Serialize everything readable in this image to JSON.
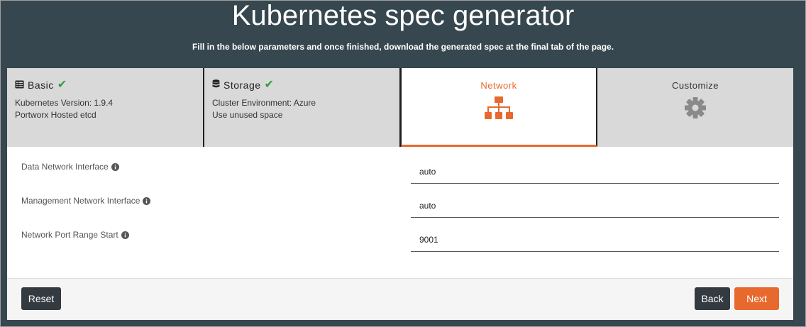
{
  "header": {
    "title": "Kubernetes spec generator",
    "subtitle": "Fill in the below parameters and once finished, download the generated spec at the final tab of the page."
  },
  "tabs": [
    {
      "label": "Basic",
      "icon": "list-icon",
      "completed": true,
      "lines": [
        "Kubernetes Version: 1.9.4",
        "Portworx Hosted etcd"
      ]
    },
    {
      "label": "Storage",
      "icon": "database-icon",
      "completed": true,
      "lines": [
        "Cluster Environment: Azure",
        "Use unused space"
      ]
    },
    {
      "label": "Network",
      "icon": "sitemap-icon",
      "active": true
    },
    {
      "label": "Customize",
      "icon": "gear-icon"
    }
  ],
  "form": {
    "fields": [
      {
        "label": "Data Network Interface",
        "value": "auto"
      },
      {
        "label": "Management Network Interface",
        "value": "auto"
      },
      {
        "label": "Network Port Range Start",
        "value": "9001"
      }
    ]
  },
  "footer": {
    "reset_label": "Reset",
    "back_label": "Back",
    "next_label": "Next"
  },
  "colors": {
    "background": "#37474f",
    "accent": "#e8692e",
    "check": "#2e9e3e",
    "dark_button": "#333a40"
  }
}
